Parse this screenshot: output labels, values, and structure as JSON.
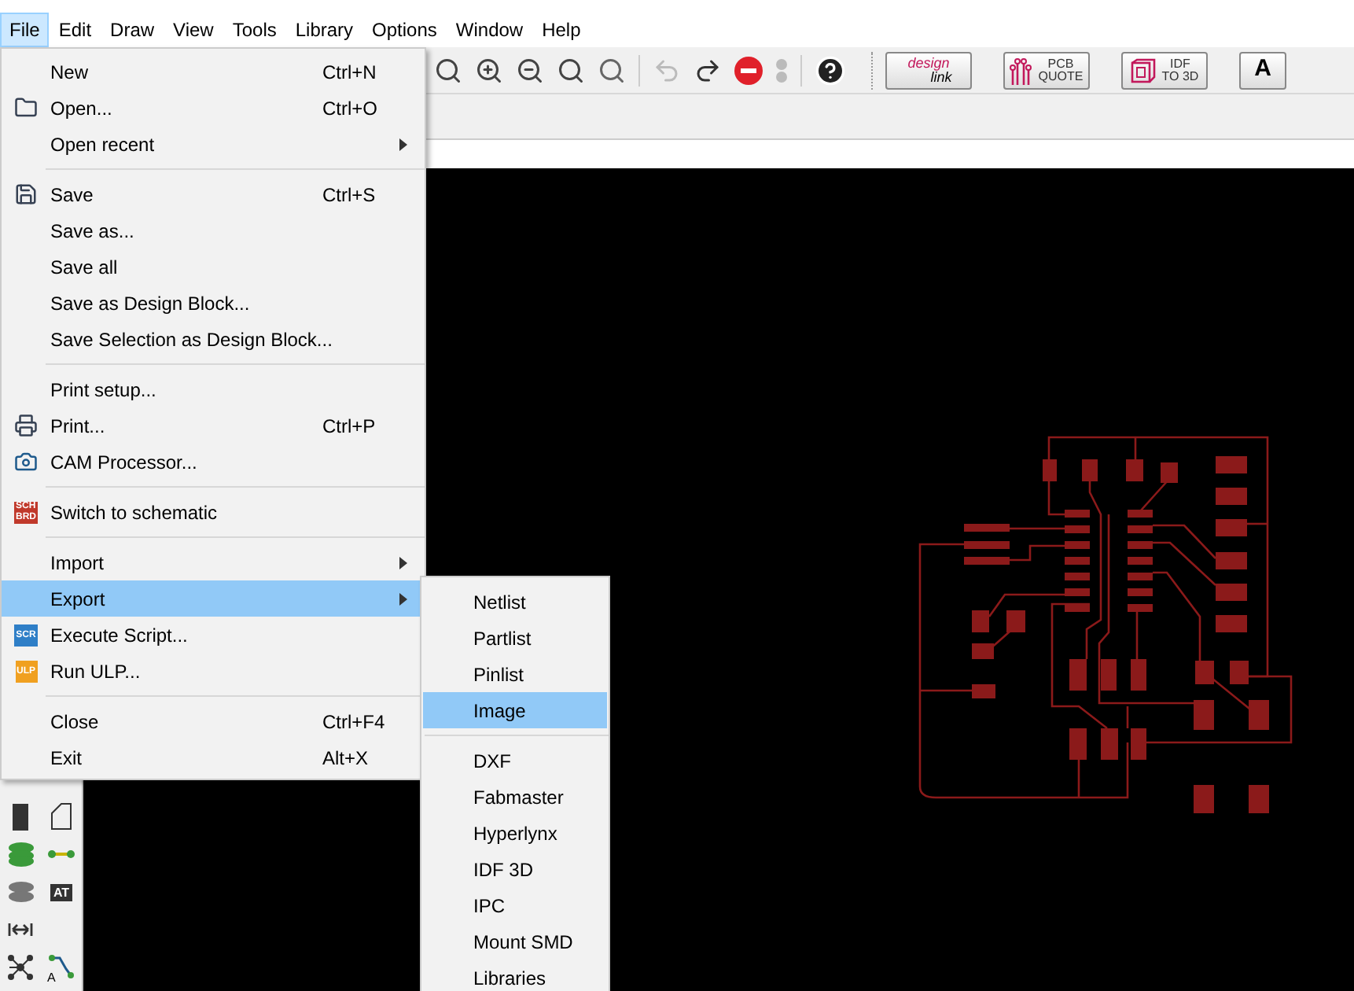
{
  "menubar": [
    {
      "label": "File",
      "selected": true
    },
    {
      "label": "Edit",
      "selected": false
    },
    {
      "label": "Draw",
      "selected": false
    },
    {
      "label": "View",
      "selected": false
    },
    {
      "label": "Tools",
      "selected": false
    },
    {
      "label": "Library",
      "selected": false
    },
    {
      "label": "Options",
      "selected": false
    },
    {
      "label": "Window",
      "selected": false
    },
    {
      "label": "Help",
      "selected": false
    }
  ],
  "toolbar": {
    "link_buttons": [
      {
        "kind": "design",
        "lines": [
          "design",
          "link"
        ]
      },
      {
        "kind": "pcb",
        "lines": [
          "PCB",
          "QUOTE"
        ]
      },
      {
        "kind": "idf",
        "lines": [
          "IDF",
          "TO 3D"
        ]
      },
      {
        "kind": "logo",
        "lines": [
          "A"
        ]
      }
    ]
  },
  "left_tools": [
    {
      "kind": "block"
    },
    {
      "kind": "outline"
    },
    {
      "kind": "stack-green"
    },
    {
      "kind": "wire"
    },
    {
      "kind": "stack"
    },
    {
      "kind": "attribute",
      "badge": "AT"
    },
    {
      "kind": "dimension"
    },
    {
      "kind": "none"
    },
    {
      "kind": "network"
    },
    {
      "kind": "route",
      "badge": "A"
    }
  ],
  "file_menu": [
    {
      "kind": "plain",
      "label": "New",
      "shortcut": "Ctrl+N",
      "submenu": false,
      "selected": false
    },
    {
      "kind": "folder",
      "label": "Open...",
      "shortcut": "Ctrl+O",
      "submenu": false,
      "selected": false
    },
    {
      "kind": "plain",
      "label": "Open recent",
      "submenu": true,
      "selected": false
    },
    {
      "kind": "separator"
    },
    {
      "kind": "disk",
      "label": "Save",
      "shortcut": "Ctrl+S",
      "submenu": false,
      "selected": false
    },
    {
      "kind": "plain",
      "label": "Save as...",
      "submenu": false,
      "selected": false
    },
    {
      "kind": "plain",
      "label": "Save all",
      "submenu": false,
      "selected": false
    },
    {
      "kind": "plain",
      "label": "Save as Design Block...",
      "submenu": false,
      "selected": false
    },
    {
      "kind": "plain",
      "label": "Save Selection as Design Block...",
      "submenu": false,
      "selected": false
    },
    {
      "kind": "separator"
    },
    {
      "kind": "plain",
      "label": "Print setup...",
      "submenu": false,
      "selected": false
    },
    {
      "kind": "printer",
      "label": "Print...",
      "shortcut": "Ctrl+P",
      "submenu": false,
      "selected": false
    },
    {
      "kind": "camera",
      "label": "CAM Processor...",
      "submenu": false,
      "selected": false
    },
    {
      "kind": "separator"
    },
    {
      "kind": "sch",
      "label": "Switch to schematic",
      "submenu": false,
      "selected": false,
      "badge": [
        "SCH",
        "BRD"
      ]
    },
    {
      "kind": "separator"
    },
    {
      "kind": "plain",
      "label": "Import",
      "submenu": true,
      "selected": false
    },
    {
      "kind": "plain",
      "label": "Export",
      "submenu": true,
      "selected": true
    },
    {
      "kind": "scr",
      "label": "Execute Script...",
      "submenu": false,
      "selected": false,
      "badge": [
        "SCR"
      ]
    },
    {
      "kind": "ulp",
      "label": "Run ULP...",
      "submenu": false,
      "selected": false,
      "badge": [
        "ULP"
      ]
    },
    {
      "kind": "separator"
    },
    {
      "kind": "plain",
      "label": "Close",
      "shortcut": "Ctrl+F4",
      "submenu": false,
      "selected": false
    },
    {
      "kind": "plain",
      "label": "Exit",
      "shortcut": "Alt+X",
      "submenu": false,
      "selected": false
    }
  ],
  "export_menu": [
    {
      "kind": "item",
      "label": "Netlist",
      "selected": false
    },
    {
      "kind": "item",
      "label": "Partlist",
      "selected": false
    },
    {
      "kind": "item",
      "label": "Pinlist",
      "selected": false
    },
    {
      "kind": "item",
      "label": "Image",
      "selected": true
    },
    {
      "kind": "separator"
    },
    {
      "kind": "item",
      "label": "DXF",
      "selected": false
    },
    {
      "kind": "item",
      "label": "Fabmaster",
      "selected": false
    },
    {
      "kind": "item",
      "label": "Hyperlynx",
      "selected": false
    },
    {
      "kind": "item",
      "label": "IDF 3D",
      "selected": false
    },
    {
      "kind": "item",
      "label": "IPC",
      "selected": false
    },
    {
      "kind": "item",
      "label": "Mount SMD",
      "selected": false
    },
    {
      "kind": "item",
      "label": "Libraries",
      "selected": false
    }
  ]
}
